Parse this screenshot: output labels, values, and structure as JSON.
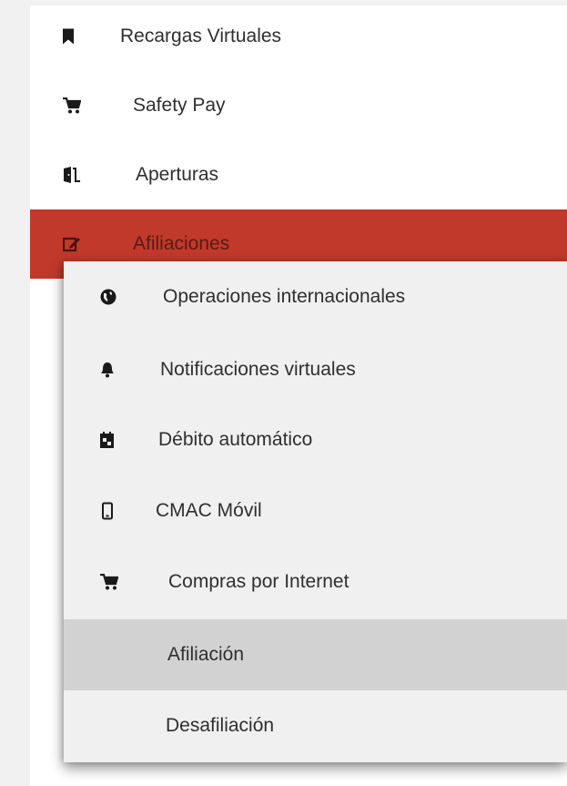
{
  "sidebar": {
    "items": [
      {
        "label": "Recargas Virtuales",
        "icon": "bookmark-icon"
      },
      {
        "label": "Safety Pay",
        "icon": "cart-icon"
      },
      {
        "label": "Aperturas",
        "icon": "door-open-icon"
      },
      {
        "label": "Afiliaciones",
        "icon": "edit-icon",
        "active": true
      }
    ]
  },
  "submenu": {
    "items": [
      {
        "label": "Operaciones internacionales",
        "icon": "globe-icon"
      },
      {
        "label": "Notificaciones virtuales",
        "icon": "bell-icon"
      },
      {
        "label": "Débito automático",
        "icon": "calendar-icon"
      },
      {
        "label": "CMAC Móvil",
        "icon": "mobile-icon"
      },
      {
        "label": "Compras por Internet",
        "icon": "cart-icon"
      },
      {
        "label": "Afiliación",
        "selected": true
      },
      {
        "label": "Desafiliación"
      }
    ]
  },
  "colors": {
    "active_item_bg": "#c0392b",
    "selected_subitem_bg": "#d2d2d2",
    "submenu_bg": "#f0f0f0"
  }
}
